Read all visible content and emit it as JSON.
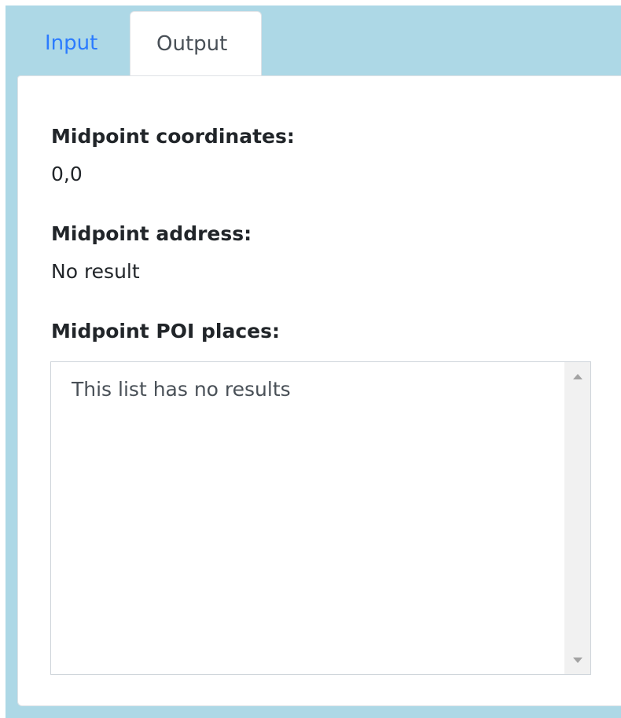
{
  "tabs": [
    {
      "label": "Input",
      "active": false
    },
    {
      "label": "Output",
      "active": true
    }
  ],
  "output": {
    "coordinates_label": "Midpoint coordinates:",
    "coordinates_value": "0,0",
    "address_label": "Midpoint address:",
    "address_value": "No result",
    "poi_label": "Midpoint POI places:",
    "poi_empty_text": "This list has no results"
  },
  "colors": {
    "frame_background": "#add8e6",
    "active_link": "#2b7bff",
    "panel_background": "#ffffff"
  }
}
